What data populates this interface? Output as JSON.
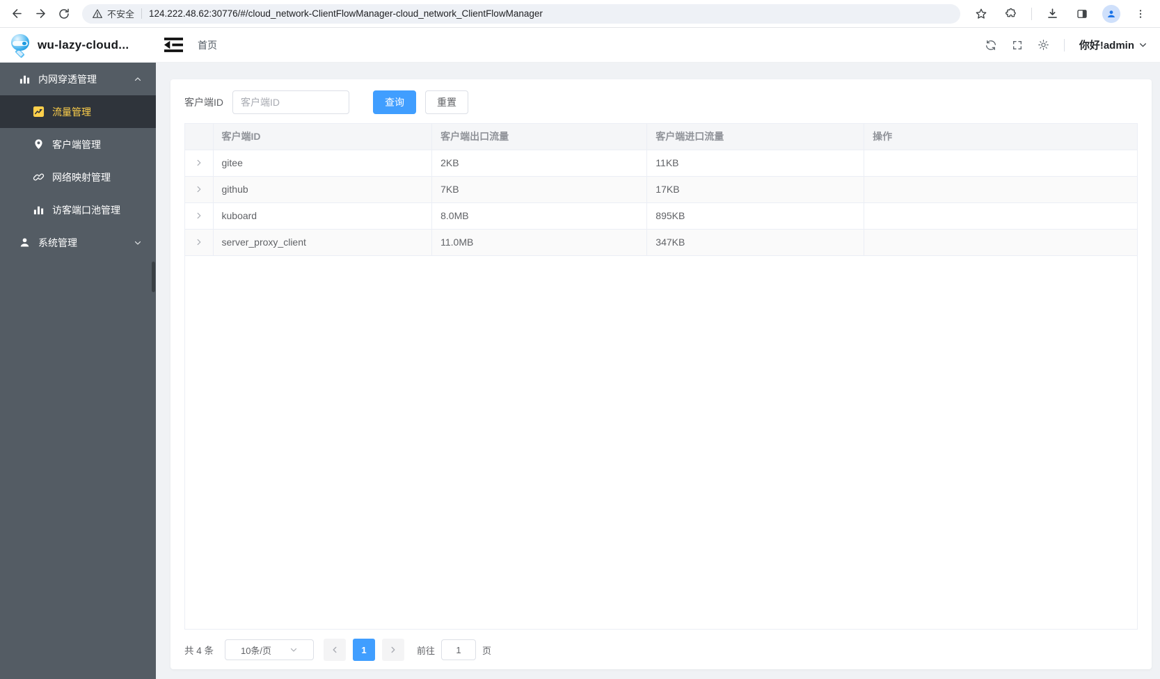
{
  "browser": {
    "security_label": "不安全",
    "url": "124.222.48.62:30776/#/cloud_network-ClientFlowManager-cloud_network_ClientFlowManager"
  },
  "header": {
    "app_title": "wu-lazy-cloud...",
    "breadcrumb_home": "首页",
    "greeting": "你好!admin"
  },
  "sidebar": {
    "groups": [
      {
        "label": "内网穿透管理",
        "items": [
          {
            "label": "流量管理"
          },
          {
            "label": "客户端管理"
          },
          {
            "label": "网络映射管理"
          },
          {
            "label": "访客端口池管理"
          }
        ]
      },
      {
        "label": "系统管理"
      }
    ]
  },
  "filters": {
    "client_id_label": "客户端ID",
    "client_id_placeholder": "客户端ID",
    "query_label": "查询",
    "reset_label": "重置"
  },
  "table": {
    "columns": {
      "client_id": "客户端ID",
      "out_flow": "客户端出口流量",
      "in_flow": "客户端进口流量",
      "actions": "操作"
    },
    "rows": [
      {
        "client_id": "gitee",
        "out_flow": "2KB",
        "in_flow": "11KB"
      },
      {
        "client_id": "github",
        "out_flow": "7KB",
        "in_flow": "17KB"
      },
      {
        "client_id": "kuboard",
        "out_flow": "8.0MB",
        "in_flow": "895KB"
      },
      {
        "client_id": "server_proxy_client",
        "out_flow": "11.0MB",
        "in_flow": "347KB"
      }
    ]
  },
  "pagination": {
    "total_label": "共 4 条",
    "page_size_label": "10条/页",
    "current_page": "1",
    "goto_label": "前往",
    "goto_value": "1",
    "unit_label": "页"
  },
  "colors": {
    "accent": "#409eff",
    "sidebar_bg": "#545c64",
    "sidebar_active_bg": "#2f343b",
    "sidebar_active_text": "#ffd04b",
    "table_header_bg": "#f5f6f8"
  }
}
